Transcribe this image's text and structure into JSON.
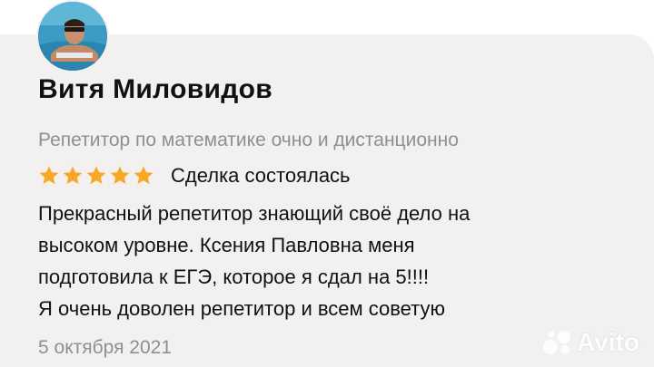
{
  "review": {
    "reviewer_name": "Витя Миловидов",
    "service": "Репетитор по математике очно и дистанционно",
    "rating": 5,
    "rating_max": 5,
    "deal_status": "Сделка состоялась",
    "text_lines": [
      "Прекрасный репетитор знающий своё дело на",
      "высоком уровне. Ксения Павловна меня",
      "подготовила к ЕГЭ, которое я сдал на 5!!!!",
      "Я очень доволен репетитор и всем советую"
    ],
    "date": "5 октября 2021"
  },
  "watermark": {
    "text": "Avito"
  },
  "icons": {
    "avatar": "user-avatar-photo",
    "star": "star-icon",
    "logo": "avito-logo-icon"
  },
  "colors": {
    "card_background": "#f2f1f0",
    "star": "#f9a825",
    "secondary_text": "#8f8f8f",
    "primary_text": "#111111"
  }
}
